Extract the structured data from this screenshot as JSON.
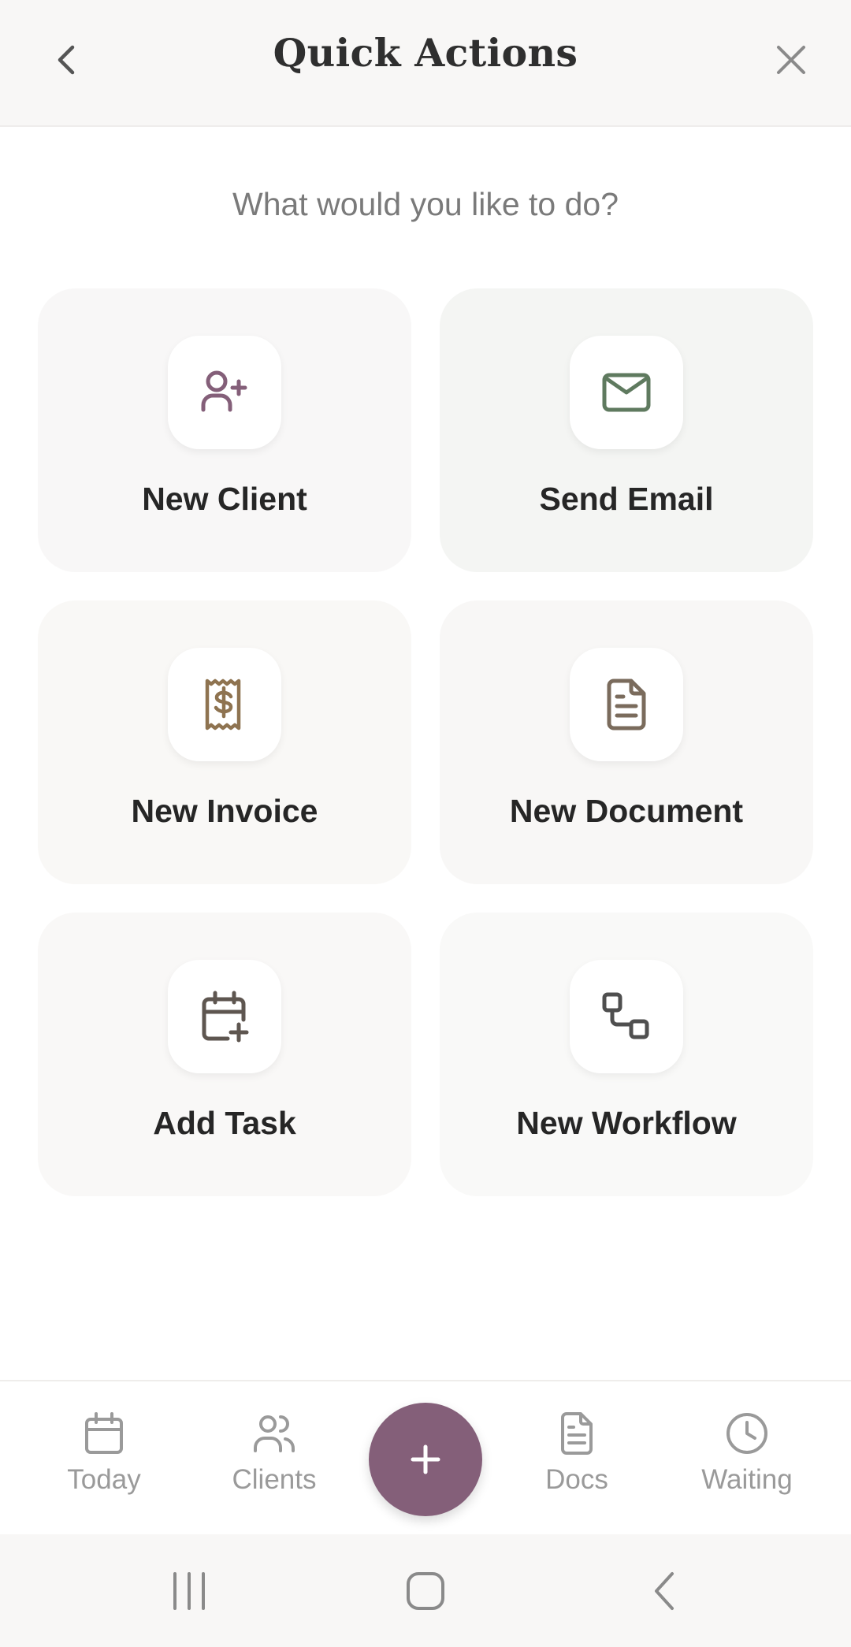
{
  "header": {
    "title": "Quick Actions",
    "back_icon": "chevron-left-icon",
    "close_icon": "close-icon"
  },
  "subtitle": "What would you like to do?",
  "actions": [
    {
      "label": "New Client",
      "icon": "user-plus-icon",
      "bg": "#f8f7f7",
      "icon_color": "#845f79"
    },
    {
      "label": "Send Email",
      "icon": "mail-icon",
      "bg": "#f4f5f3",
      "icon_color": "#5f7a5f"
    },
    {
      "label": "New Invoice",
      "icon": "receipt-dollar-icon",
      "bg": "#f9f8f6",
      "icon_color": "#8e7350"
    },
    {
      "label": "New Document",
      "icon": "document-icon",
      "bg": "#f8f7f6",
      "icon_color": "#7a6b5c"
    },
    {
      "label": "Add Task",
      "icon": "calendar-plus-icon",
      "bg": "#f9f8f7",
      "icon_color": "#5e5650"
    },
    {
      "label": "New Workflow",
      "icon": "workflow-icon",
      "bg": "#f9f9f8",
      "icon_color": "#4f4f4f"
    }
  ],
  "bottom_nav": {
    "items": [
      {
        "label": "Today",
        "icon": "calendar-icon"
      },
      {
        "label": "Clients",
        "icon": "users-icon"
      },
      {
        "label": "Docs",
        "icon": "document-icon"
      },
      {
        "label": "Waiting",
        "icon": "clock-icon"
      }
    ],
    "fab_icon": "plus-icon",
    "fab_color": "#845f79"
  },
  "system_nav": [
    "recent-apps-icon",
    "home-icon",
    "system-back-icon"
  ]
}
